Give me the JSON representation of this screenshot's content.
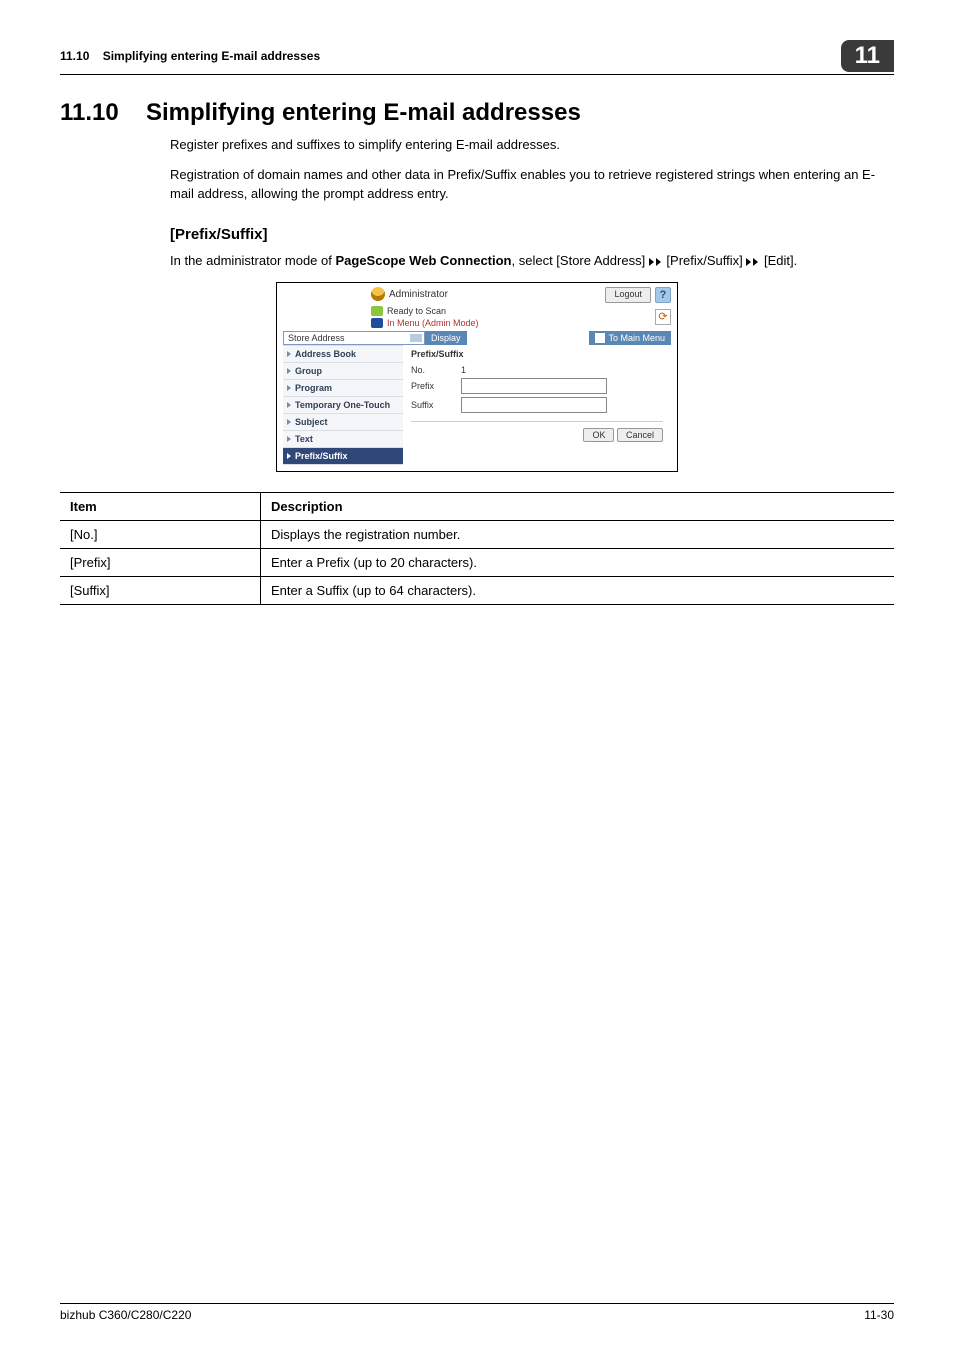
{
  "header": {
    "section_num": "11.10",
    "section_title": "Simplifying entering E-mail addresses",
    "chapter": "11"
  },
  "heading": {
    "num": "11.10",
    "title": "Simplifying entering E-mail addresses"
  },
  "intro": {
    "p1": "Register prefixes and suffixes to simplify entering E-mail addresses.",
    "p2": "Registration of domain names and other data in Prefix/Suffix enables you to retrieve registered strings when entering an E-mail address, allowing the prompt address entry."
  },
  "subhead": "[Prefix/Suffix]",
  "instruction": {
    "prefix": "In the administrator mode of ",
    "bold": "PageScope Web Connection",
    "mid1": ", select [Store Address] ",
    "mid2": " [Prefix/Suffix] ",
    "suffix": " [Edit]."
  },
  "screenshot": {
    "admin": "Administrator",
    "logout": "Logout",
    "help": "?",
    "ready": "Ready to Scan",
    "menu_mode": "In Menu (Admin Mode)",
    "select_value": "Store Address",
    "display": "Display",
    "to_main": "To Main Menu",
    "nav": {
      "address_book": "Address Book",
      "group": "Group",
      "program": "Program",
      "temp_one_touch": "Temporary One-Touch",
      "subject": "Subject",
      "text": "Text",
      "prefix_suffix": "Prefix/Suffix"
    },
    "content": {
      "title": "Prefix/Suffix",
      "no_label": "No.",
      "no_value": "1",
      "prefix_label": "Prefix",
      "suffix_label": "Suffix",
      "ok": "OK",
      "cancel": "Cancel"
    }
  },
  "table": {
    "head_item": "Item",
    "head_desc": "Description",
    "rows": [
      {
        "item": "[No.]",
        "desc": "Displays the registration number."
      },
      {
        "item": "[Prefix]",
        "desc": "Enter a Prefix (up to 20 characters)."
      },
      {
        "item": "[Suffix]",
        "desc": "Enter a Suffix (up to 64 characters)."
      }
    ]
  },
  "footer": {
    "left": "bizhub C360/C280/C220",
    "right": "11-30"
  }
}
